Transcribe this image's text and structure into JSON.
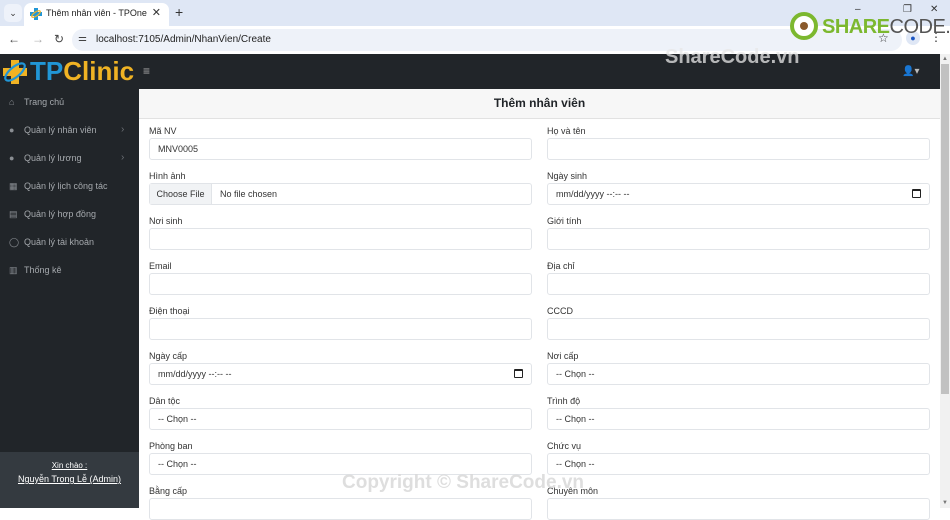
{
  "browser": {
    "tab_title": "Thêm nhân viên - TPOne",
    "tab_close": "✕",
    "new_tab": "+",
    "url": "localhost:7105/Admin/NhanVien/Create",
    "minimize": "–",
    "restore": "❐",
    "close": "✕"
  },
  "watermarks": {
    "logo_main": "SHARE",
    "logo_sub": "CODE.vn",
    "top": "ShareCode.vn",
    "bottom": "Copyright © ShareCode.vn"
  },
  "topnav": {
    "brand_tp": "TP",
    "brand_clinic": "Clinic",
    "hamburger": "≡",
    "user_icon": "👤▾"
  },
  "sidebar": {
    "items": [
      {
        "label": "Trang chủ",
        "icon": "⌂",
        "has_arrow": false
      },
      {
        "label": "Quản lý nhân viên",
        "icon": "●",
        "has_arrow": true
      },
      {
        "label": "Quản lý lương",
        "icon": "●",
        "has_arrow": true
      },
      {
        "label": "Quản lý lịch công tác",
        "icon": "▦",
        "has_arrow": false
      },
      {
        "label": "Quản lý hợp đồng",
        "icon": "▤",
        "has_arrow": false
      },
      {
        "label": "Quản lý tài khoản",
        "icon": "◯",
        "has_arrow": false
      },
      {
        "label": "Thống kê",
        "icon": "▥",
        "has_arrow": false
      }
    ],
    "arrow": "›",
    "greeting": "Xin chào :",
    "username": "Nguyễn Trọng Lễ (Admin)"
  },
  "form": {
    "title": "Thêm nhân viên",
    "fields": {
      "ma_nv": {
        "label": "Mã NV",
        "value": "MNV0005"
      },
      "ho_ten": {
        "label": "Họ và tên",
        "value": ""
      },
      "hinh_anh": {
        "label": "Hình ảnh",
        "button": "Choose File",
        "value": "No file chosen"
      },
      "ngay_sinh": {
        "label": "Ngày sinh",
        "value": "mm/dd/yyyy --:-- --"
      },
      "noi_sinh": {
        "label": "Nơi sinh",
        "value": ""
      },
      "gioi_tinh": {
        "label": "Giới tính",
        "value": ""
      },
      "email": {
        "label": "Email",
        "value": ""
      },
      "dia_chi": {
        "label": "Địa chỉ",
        "value": ""
      },
      "dien_thoai": {
        "label": "Điện thoại",
        "value": ""
      },
      "cccd": {
        "label": "CCCD",
        "value": ""
      },
      "ngay_cap": {
        "label": "Ngày cấp",
        "value": "mm/dd/yyyy --:-- --"
      },
      "noi_cap": {
        "label": "Nơi cấp",
        "value": "-- Chọn --"
      },
      "dan_toc": {
        "label": "Dân tộc",
        "value": "-- Chọn --"
      },
      "trinh_do": {
        "label": "Trình độ",
        "value": "-- Chọn --"
      },
      "phong_ban": {
        "label": "Phòng ban",
        "value": "-- Chọn --"
      },
      "chuc_vu": {
        "label": "Chức vụ",
        "value": "-- Chọn --"
      },
      "bang_cap": {
        "label": "Bằng cấp",
        "value": ""
      },
      "chuyen_mon": {
        "label": "Chuyên môn",
        "value": ""
      }
    }
  }
}
